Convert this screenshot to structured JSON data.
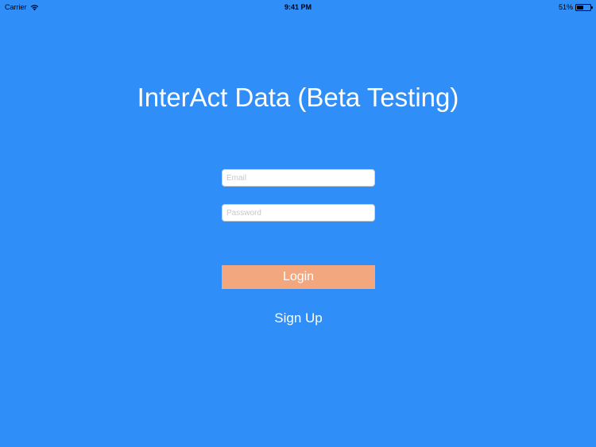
{
  "status_bar": {
    "carrier": "Carrier",
    "time": "9:41 PM",
    "battery_text": "51%",
    "battery_level": 0.51,
    "wifi_icon": "wifi-icon",
    "battery_icon": "battery-icon"
  },
  "app": {
    "title": "InterAct Data (Beta Testing)"
  },
  "form": {
    "email_placeholder": "Email",
    "email_value": "",
    "password_placeholder": "Password",
    "password_value": "",
    "login_label": "Login",
    "signup_label": "Sign Up"
  },
  "colors": {
    "background": "#2f8ef7",
    "login_button": "#f3a77e",
    "text": "#ffffff"
  }
}
